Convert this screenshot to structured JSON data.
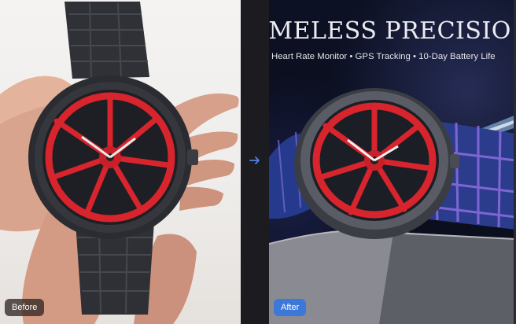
{
  "comparison": {
    "before_label": "Before",
    "after_label": "After"
  },
  "after_panel": {
    "headline": "IMELESS PRECISIO",
    "subline": "Heart Rate Monitor • GPS Tracking • 10-Day Battery Life"
  },
  "icons": {
    "arrow": "arrow-right-icon"
  },
  "colors": {
    "accent_blue": "#3c78d8",
    "watch_red": "#d8242d",
    "before_bg": "#f1efed",
    "after_bg": "#0c0f22"
  }
}
